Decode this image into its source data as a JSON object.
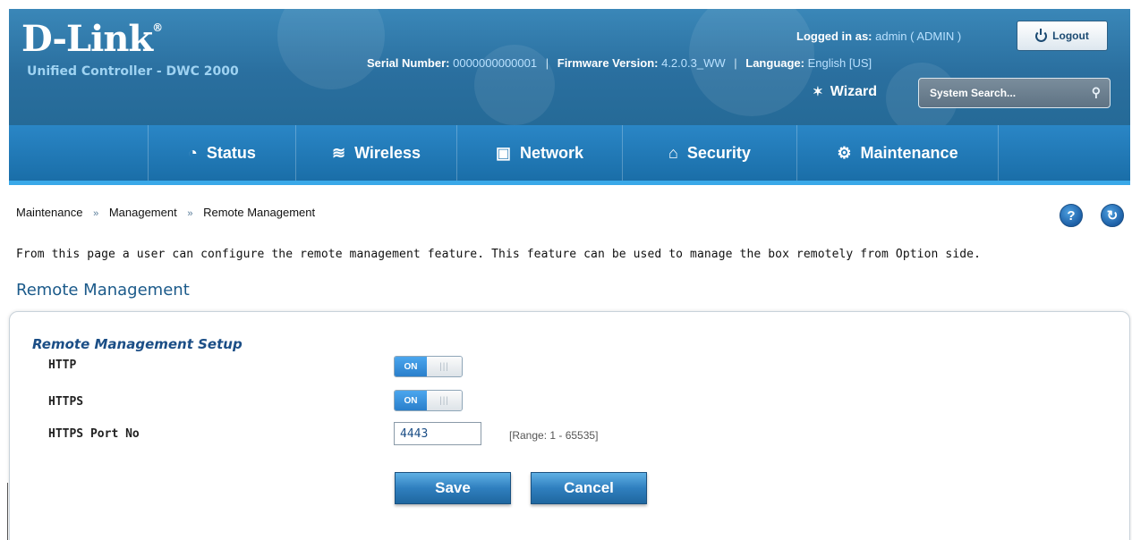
{
  "header": {
    "brand": "D-Link",
    "brand_mark": "®",
    "product": "Unified Controller - DWC 2000",
    "logged_in_label": "Logged in as:",
    "logged_in_value": "admin ( ADMIN )",
    "logout_label": "Logout",
    "serial_label": "Serial Number:",
    "serial_value": "0000000000001",
    "firmware_label": "Firmware Version:",
    "firmware_value": "4.2.0.3_WW",
    "language_label": "Language:",
    "language_value": "English [US]",
    "separator": "|",
    "wizard_label": "Wizard",
    "search_placeholder": "System Search..."
  },
  "nav": {
    "items": [
      {
        "label": "Status",
        "icon": "gauge-icon"
      },
      {
        "label": "Wireless",
        "icon": "wifi-icon"
      },
      {
        "label": "Network",
        "icon": "monitor-icon"
      },
      {
        "label": "Security",
        "icon": "lock-icon"
      },
      {
        "label": "Maintenance",
        "icon": "gears-icon",
        "active": true
      }
    ]
  },
  "breadcrumb": {
    "items": [
      "Maintenance",
      "Management",
      "Remote Management"
    ],
    "separator": "»"
  },
  "page": {
    "description": "From this page a user can configure the remote management feature. This feature can be used to manage the box remotely from Option side.",
    "section_title": "Remote Management"
  },
  "form": {
    "title": "Remote Management Setup",
    "http_label": "HTTP",
    "http_state": "ON",
    "https_label": "HTTPS",
    "https_state": "ON",
    "port_label": "HTTPS Port No",
    "port_value": "4443",
    "port_range": "[Range: 1 - 65535]",
    "save_label": "Save",
    "cancel_label": "Cancel"
  },
  "colors": {
    "header_bg": "#2a6f9f",
    "nav_bg": "#1a6ea8",
    "accent": "#3aa8e8",
    "title_text": "#1b5a8a"
  }
}
